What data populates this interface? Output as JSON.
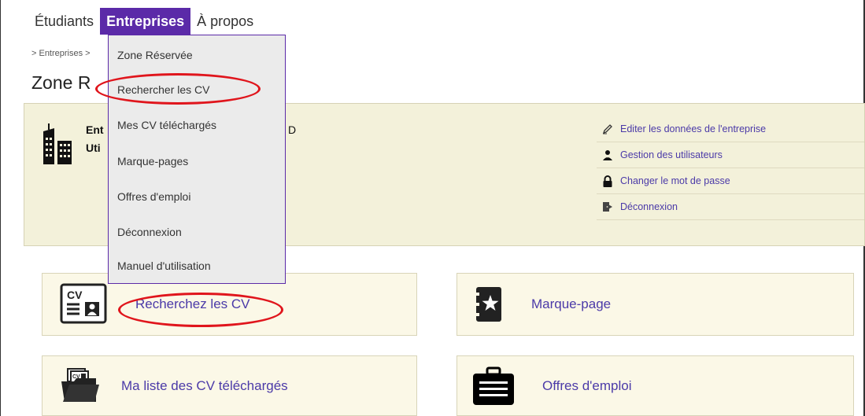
{
  "nav": {
    "items": [
      {
        "label": "Étudiants"
      },
      {
        "label": "Entreprises"
      },
      {
        "label": "À propos"
      }
    ]
  },
  "breadcrumb": "> Entreprises >",
  "page_title": "Zone R",
  "company": {
    "line1": "Ent",
    "line2": "Uti",
    "trail": "D"
  },
  "actions": [
    {
      "label": "Editer les données de l'entreprise",
      "icon": "pencil-icon"
    },
    {
      "label": "Gestion des utilisateurs",
      "icon": "users-icon"
    },
    {
      "label": "Changer le mot de passe",
      "icon": "lock-icon"
    },
    {
      "label": "Déconnexion",
      "icon": "logout-icon"
    }
  ],
  "dropdown": {
    "items": [
      {
        "label": "Zone Réservée"
      },
      {
        "label": "Rechercher les CV"
      },
      {
        "label": "Mes CV téléchargés"
      },
      {
        "label": "Marque-pages"
      },
      {
        "label": "Offres d'emploi"
      },
      {
        "label": "Déconnexion"
      },
      {
        "label": "Manuel d'utilisation"
      }
    ]
  },
  "tiles": [
    {
      "label": "Recherchez les CV",
      "icon": "cv-card-icon"
    },
    {
      "label": "Marque-page",
      "icon": "bookmark-star-icon"
    },
    {
      "label": "Ma liste des CV téléchargés",
      "icon": "cv-folder-icon"
    },
    {
      "label": "Offres d'emploi",
      "icon": "briefcase-icon"
    }
  ],
  "colors": {
    "accent": "#5b2aa8",
    "link": "#4b3aa8",
    "panel": "#f3f1da",
    "highlight_ring": "#e0151c"
  }
}
